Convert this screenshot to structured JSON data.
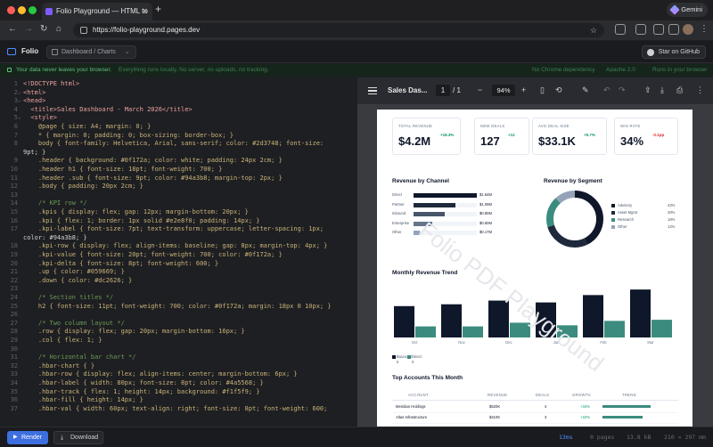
{
  "browser": {
    "tab_title": "Folio Playground — HTML to",
    "url": "https://folio-playground.pages.dev",
    "gemini_label": "Gemini"
  },
  "app": {
    "brand": "Folio",
    "breadcrumb": "Dashboard / Charts",
    "github_button": "Star on GitHub"
  },
  "privacy": {
    "primary": "Your data never leaves your browser.",
    "secondary": "Everything runs locally. No server, no uploads, no tracking.",
    "right": [
      "No Chrome dependency",
      "Apache 2.0",
      "Runs in your browser"
    ]
  },
  "editor": {
    "lines": [
      "<!DOCTYPE html>",
      "<html>",
      "<head>",
      "  <title>Sales Dashboard - March 2026</title>",
      "  <style>",
      "    @page { size: A4; margin: 0; }",
      "    * { margin: 0; padding: 0; box-sizing: border-box; }",
      "    body { font-family: Helvetica, Arial, sans-serif; color: #2d3748; font-size:",
      "9pt; }",
      "    .header { background: #0f172a; color: white; padding: 24px 2cm; }",
      "    .header h1 { font-size: 18pt; font-weight: 700; }",
      "    .header .sub { font-size: 9pt; color: #94a3b8; margin-top: 2px; }",
      "    .body { padding: 20px 2cm; }",
      "",
      "    /* KPI row */",
      "    .kpis { display: flex; gap: 12px; margin-bottom: 20px; }",
      "    .kpi { flex: 1; border: 1px solid #e2e8f0; padding: 14px; }",
      "    .kpi-label { font-size: 7pt; text-transform: uppercase; letter-spacing: 1px;",
      "color: #94a3b8; }",
      "    .kpi-row { display: flex; align-items: baseline; gap: 8px; margin-top: 4px; }",
      "    .kpi-value { font-size: 20pt; font-weight: 700; color: #0f172a; }",
      "    .kpi-delta { font-size: 8pt; font-weight: 600; }",
      "    .up { color: #059669; }",
      "    .down { color: #dc2626; }",
      "",
      "    /* Section titles */",
      "    h2 { font-size: 11pt; font-weight: 700; color: #0f172a; margin: 18px 0 10px; }",
      "",
      "    /* Two column layout */",
      "    .row { display: flex; gap: 20px; margin-bottom: 16px; }",
      "    .col { flex: 1; }",
      "",
      "    /* Horizontal bar chart */",
      "    .hbar-chart { }",
      "    .hbar-row { display: flex; align-items: center; margin-bottom: 6px; }",
      "    .hbar-label { width: 80px; font-size: 8pt; color: #4a5568; }",
      "    .hbar-track { flex: 1; height: 14px; background: #f1f5f9; }",
      "    .hbar-fill { height: 14px; }",
      "    .hbar-val { width: 60px; text-align: right; font-size: 8pt; font-weight: 600;"
    ],
    "line_numbers": [
      "1",
      "2",
      "3",
      "4",
      "5",
      "6",
      "7",
      "8",
      "",
      "9",
      "10",
      "11",
      "12",
      "13",
      "14",
      "15",
      "16",
      "17",
      "",
      "18",
      "19",
      "20",
      "21",
      "22",
      "23",
      "24",
      "25",
      "26",
      "27",
      "28",
      "29",
      "30",
      "31",
      "32",
      "33",
      "34",
      "35",
      "36",
      "37",
      "38"
    ]
  },
  "pdf": {
    "title": "Sales Das...",
    "page": "1",
    "page_total": "/ 1",
    "zoom": "94%",
    "watermark": "Folio PDF Playground",
    "kpis": [
      {
        "label": "TOTAL REVENUE",
        "value": "$4.2M",
        "delta": "+18.3%",
        "dir": "up"
      },
      {
        "label": "NEW DEALS",
        "value": "127",
        "delta": "+12",
        "dir": "up"
      },
      {
        "label": "AVG DEAL SIZE",
        "value": "$33.1K",
        "delta": "+5.7%",
        "dir": "up"
      },
      {
        "label": "WIN RATE",
        "value": "34%",
        "delta": "-2.1pp",
        "dir": "down"
      }
    ],
    "revenue_by_channel": {
      "title": "Revenue by Channel",
      "rows": [
        {
          "label": "Direct",
          "value": "$1.64M",
          "frac": 1.0,
          "color": "#0f172a"
        },
        {
          "label": "Partner",
          "value": "$1.09M",
          "frac": 0.66,
          "color": "#1e293b"
        },
        {
          "label": "Inbound",
          "value": "$0.80M",
          "frac": 0.49,
          "color": "#475569"
        },
        {
          "label": "Enterprise",
          "value": "$0.50M",
          "frac": 0.3,
          "color": "#64748b"
        },
        {
          "label": "Other",
          "value": "$0.17M",
          "frac": 0.1,
          "color": "#94a3b8"
        }
      ]
    },
    "revenue_by_segment": {
      "title": "Revenue by Segment",
      "items": [
        {
          "label": "Advisory",
          "pct": "43%",
          "value": 43,
          "color": "#0f172a"
        },
        {
          "label": "Asset Mgmt",
          "pct": "28%",
          "value": 28,
          "color": "#1e293b"
        },
        {
          "label": "Research",
          "pct": "18%",
          "value": 18,
          "color": "#3b8c7e"
        },
        {
          "label": "Other",
          "pct": "12%",
          "value": 12,
          "color": "#94a3b8"
        }
      ]
    },
    "monthly_trend": {
      "title": "Monthly Revenue Trend",
      "legend": [
        "Bounced",
        "Direct"
      ],
      "legend_values": [
        "0",
        "0"
      ]
    },
    "top_accounts": {
      "title": "Top Accounts This Month",
      "headers": [
        "ACCOUNT",
        "REVENUE",
        "DEALS",
        "GROWTH",
        "TREND"
      ],
      "rows": [
        {
          "account": "Meridian Holdings",
          "revenue": "$520K",
          "deals": "4",
          "growth": "+34%",
          "trend": 0.9
        },
        {
          "account": "Atlas Infrastructure",
          "revenue": "$410K",
          "deals": "3",
          "growth": "+22%",
          "trend": 0.75
        }
      ]
    }
  },
  "chart_data": {
    "type": "bar",
    "categories": [
      "Oct",
      "Nov",
      "Dec",
      "Jan",
      "Feb",
      "Mar"
    ],
    "series": [
      {
        "name": "Bounced",
        "values": [
          85,
          90,
          100,
          95,
          115,
          130
        ],
        "color": "#0f172a"
      },
      {
        "name": "Direct",
        "values": [
          30,
          30,
          40,
          33,
          45,
          48
        ],
        "color": "#3b8c7e"
      }
    ],
    "title": "Monthly Revenue Trend",
    "xlabel": "",
    "ylabel": ""
  },
  "bottom": {
    "render": "Render",
    "download": "Download",
    "time": "13ms",
    "pages": "0 pages",
    "size": "13.8 kB",
    "dims": "210 × 297 mm"
  }
}
